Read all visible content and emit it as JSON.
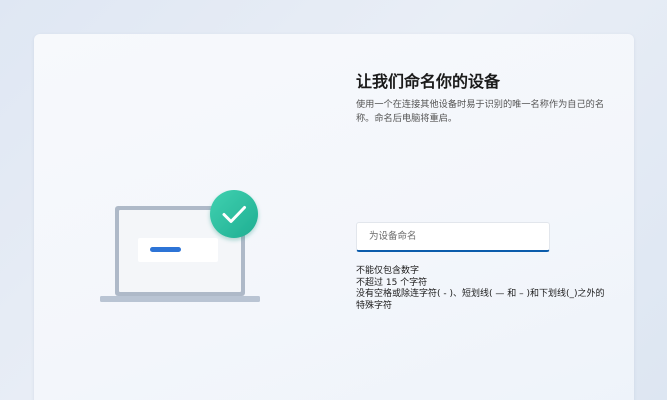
{
  "setup": {
    "title": "让我们命名你的设备",
    "description": "使用一个在连接其他设备时易于识别的唯一名称作为自己的名称。命名后电脑将重启。",
    "name_input": {
      "value": "",
      "placeholder": "为设备命名"
    },
    "rules": [
      "不能仅包含数字",
      "不超过 15 个字符",
      "没有空格或除连字符( - )、短划线( — 和 – )和下划线(_)之外的特殊字符"
    ]
  },
  "icons": {
    "laptop": "laptop-icon",
    "checkmark": "checkmark-icon"
  },
  "colors": {
    "accent": "#0b5cab",
    "check_badge": "#2dbfa0",
    "laptop_frame": "#aeb9c8",
    "bar": "#2d74d6"
  }
}
